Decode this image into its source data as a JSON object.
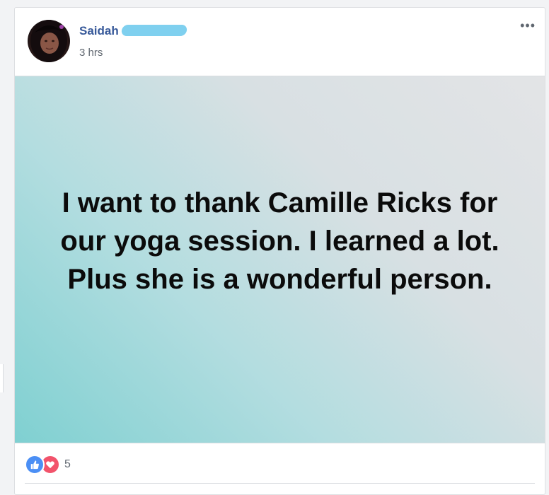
{
  "post": {
    "author": "Saidah",
    "timestamp": "3 hrs",
    "more_icon": "•••",
    "status_text": "I want to thank Camille Ricks for our yoga session. I learned a lot. Plus she is a wonderful person.",
    "background_gradient": [
      "#7fd0d1",
      "#e3e4e6"
    ],
    "reactions": {
      "icons": [
        "like-icon",
        "love-icon"
      ],
      "count": "5"
    }
  },
  "colors": {
    "author_link": "#365899",
    "meta_text": "#606770",
    "like": "#4b8ff5",
    "love": "#f2536b"
  }
}
